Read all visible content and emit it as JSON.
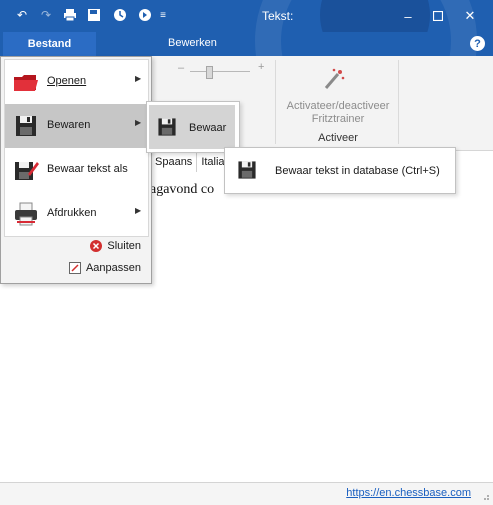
{
  "window": {
    "title": "Tekst:",
    "qat_icons": [
      "undo-icon",
      "redo-icon",
      "print-icon",
      "save-icon",
      "engine-icon",
      "engine-settings-icon",
      "customize-qat-icon"
    ],
    "controls": [
      "minimize-icon",
      "maximize-icon",
      "close-icon"
    ]
  },
  "ribbon": {
    "file_tab": "Bestand",
    "tabs": [
      "Bewerken"
    ],
    "help_icon": "?",
    "zoom_minus": "–",
    "zoom_plus": "+",
    "fritz_button_label": "Activateer/deactiveer Fritztrainer",
    "group_label": "Activeer"
  },
  "file_menu": {
    "items": [
      {
        "label": "Openen",
        "has_submenu": true,
        "icon": "open-folder-icon"
      },
      {
        "label": "Bewaren",
        "has_submenu": true,
        "icon": "floppy-disk-icon",
        "highlighted": true
      },
      {
        "label": "Bewaar tekst als",
        "has_submenu": false,
        "icon": "save-as-icon"
      },
      {
        "label": "Afdrukken",
        "has_submenu": true,
        "icon": "printer-icon"
      }
    ],
    "close_label": "Sluiten",
    "customize_label": "Aanpassen"
  },
  "submenu_bewaren": {
    "item_label": "Bewaar"
  },
  "submenu_bewaar": {
    "item_label": "Bewaar tekst in database (Ctrl+S)"
  },
  "document": {
    "language_tabs": [
      "Spaans",
      "Italia"
    ],
    "visible_text": "agavond co"
  },
  "statusbar": {
    "link": "https://en.chessbase.com"
  },
  "colors": {
    "titlebar": "#1f5fb0",
    "file_tab": "#2b6cc4",
    "highlight": "#c6c6c6",
    "link": "#1a5fc0"
  }
}
